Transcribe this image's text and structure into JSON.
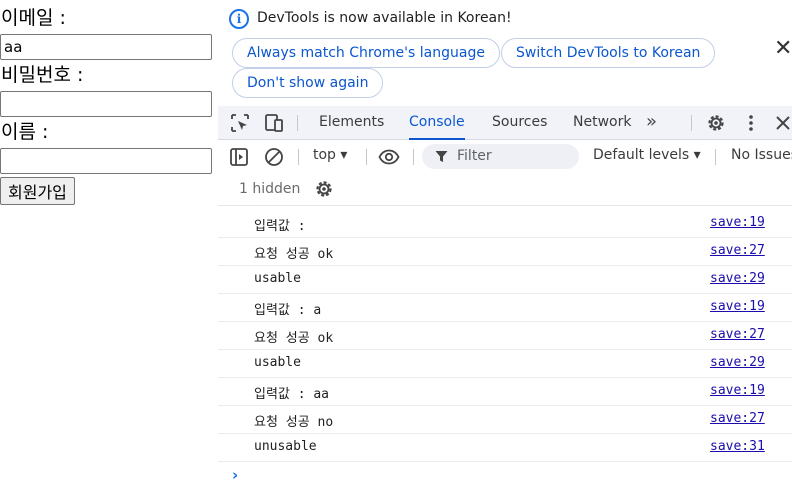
{
  "form": {
    "email_label": "이메일 :",
    "email_value": "aa",
    "password_label": "비밀번호 :",
    "password_value": "",
    "name_label": "이름 :",
    "name_value": "",
    "submit_label": "회원가입"
  },
  "infobar": {
    "message": "DevTools is now available in Korean!",
    "always_match": "Always match Chrome's language",
    "switch_korean": "Switch DevTools to Korean",
    "dont_show": "Don't show again",
    "close": "✕"
  },
  "tabs": {
    "elements": "Elements",
    "console": "Console",
    "sources": "Sources",
    "network": "Network",
    "more": "»"
  },
  "toolbar": {
    "context": "top ▾",
    "filter_placeholder": "Filter",
    "levels": "Default levels ▾",
    "issues": "No Issues"
  },
  "hidden": {
    "label": "1 hidden"
  },
  "console_rows": [
    {
      "message": "입력값 :",
      "source": "save:19"
    },
    {
      "message": "요청 성공 ok",
      "source": "save:27"
    },
    {
      "message": "usable",
      "source": "save:29"
    },
    {
      "message": "입력값 : a",
      "source": "save:19"
    },
    {
      "message": "요청 성공 ok",
      "source": "save:27"
    },
    {
      "message": "usable",
      "source": "save:29"
    },
    {
      "message": "입력값 : aa",
      "source": "save:19"
    },
    {
      "message": "요청 성공 no",
      "source": "save:27"
    },
    {
      "message": "unusable",
      "source": "save:31"
    }
  ],
  "prompt": "›",
  "colors": {
    "accent": "#0b57d0",
    "link": "#1a0dab",
    "tabbar_bg": "#f1f3f9"
  },
  "icons": [
    "info-icon",
    "inspect-element-icon",
    "device-toolbar-icon",
    "settings-gear-icon",
    "kebab-menu-icon",
    "close-icon",
    "sidebar-toggle-icon",
    "clear-console-icon",
    "eye-icon",
    "filter-funnel-icon",
    "console-settings-gear-icon"
  ]
}
